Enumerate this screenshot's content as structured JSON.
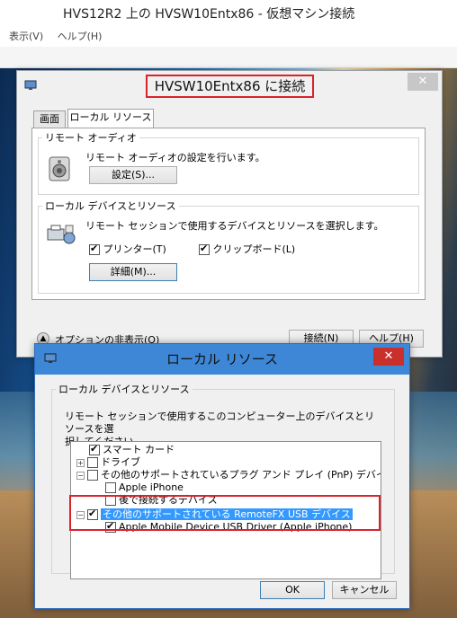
{
  "vm_window": {
    "title": "HVS12R2 上の HVSW10Entx86 - 仮想マシン接続",
    "menu": [
      "表示(V)",
      "ヘルプ(H)"
    ]
  },
  "rdp_dialog": {
    "title": "HVSW10Entx86 に接続",
    "close_glyph": "✕",
    "tabs": [
      "画面",
      "ローカル リソース"
    ],
    "audio_group": {
      "legend": "リモート オーディオ",
      "description": "リモート オーディオの設定を行います。",
      "settings_button": "設定(S)..."
    },
    "devices_group": {
      "legend": "ローカル デバイスとリソース",
      "description": "リモート セッションで使用するデバイスとリソースを選択します。",
      "printers_label": "プリンター(T)",
      "printers_checked": true,
      "clipboard_label": "クリップボード(L)",
      "clipboard_checked": true,
      "details_button": "詳細(M)..."
    },
    "options_glyph": "▲",
    "options_toggle": "オプションの非表示(O)",
    "connect_button": "接続(N)",
    "help_button": "ヘルプ(H)"
  },
  "local_resources_dialog": {
    "title": "ローカル リソース",
    "close_glyph": "✕",
    "group_legend": "ローカル デバイスとリソース",
    "description_line1": "リモート セッションで使用するこのコンピューター上のデバイスとリソースを選",
    "description_line2": "択してください。",
    "tree": {
      "smart_card": "スマート カード",
      "drives": "ドライブ",
      "pnp_devices": "その他のサポートされているプラグ アンド プレイ (PnP) デバイス",
      "apple_iphone": "Apple iPhone",
      "later_devices": "後で接続するデバイス",
      "remotefx_usb": "その他のサポートされている RemoteFX USB デバイス",
      "apple_usb_driver": "Apple Mobile Device USB Driver (Apple iPhone)"
    },
    "expander_plus": "+",
    "expander_minus": "−",
    "ok_button": "OK",
    "cancel_button": "キャンセル"
  },
  "colors": {
    "accent_blue": "#3d87d6",
    "highlight_red": "#d9232b",
    "selection_blue": "#3399ff"
  }
}
